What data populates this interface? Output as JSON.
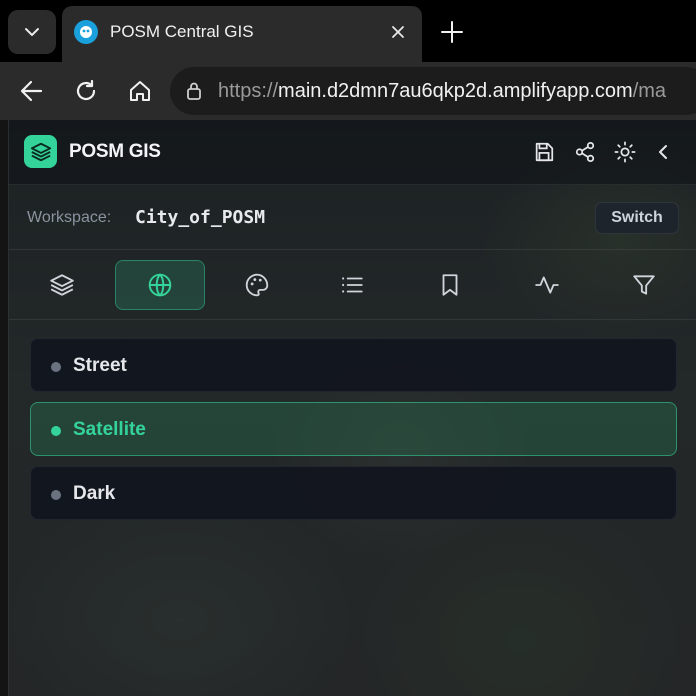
{
  "browser": {
    "tab_title": "POSM Central GIS",
    "url_scheme": "https://",
    "url_host": "main.d2dmn7au6qkp2d.amplifyapp.com",
    "url_rest": "/ma"
  },
  "app": {
    "title": "POSM GIS",
    "accent_color": "#34d399"
  },
  "workspace": {
    "label": "Workspace:",
    "value": "City_of_POSM",
    "switch_label": "Switch"
  },
  "toolbar": {
    "tabs": [
      {
        "icon": "layers-icon",
        "active": false
      },
      {
        "icon": "globe-icon",
        "active": true
      },
      {
        "icon": "palette-icon",
        "active": false
      },
      {
        "icon": "list-icon",
        "active": false
      },
      {
        "icon": "bookmark-icon",
        "active": false
      },
      {
        "icon": "activity-icon",
        "active": false
      },
      {
        "icon": "filter-icon",
        "active": false
      }
    ]
  },
  "basemaps": {
    "items": [
      {
        "label": "Street",
        "selected": false
      },
      {
        "label": "Satellite",
        "selected": true
      },
      {
        "label": "Dark",
        "selected": false
      }
    ]
  }
}
